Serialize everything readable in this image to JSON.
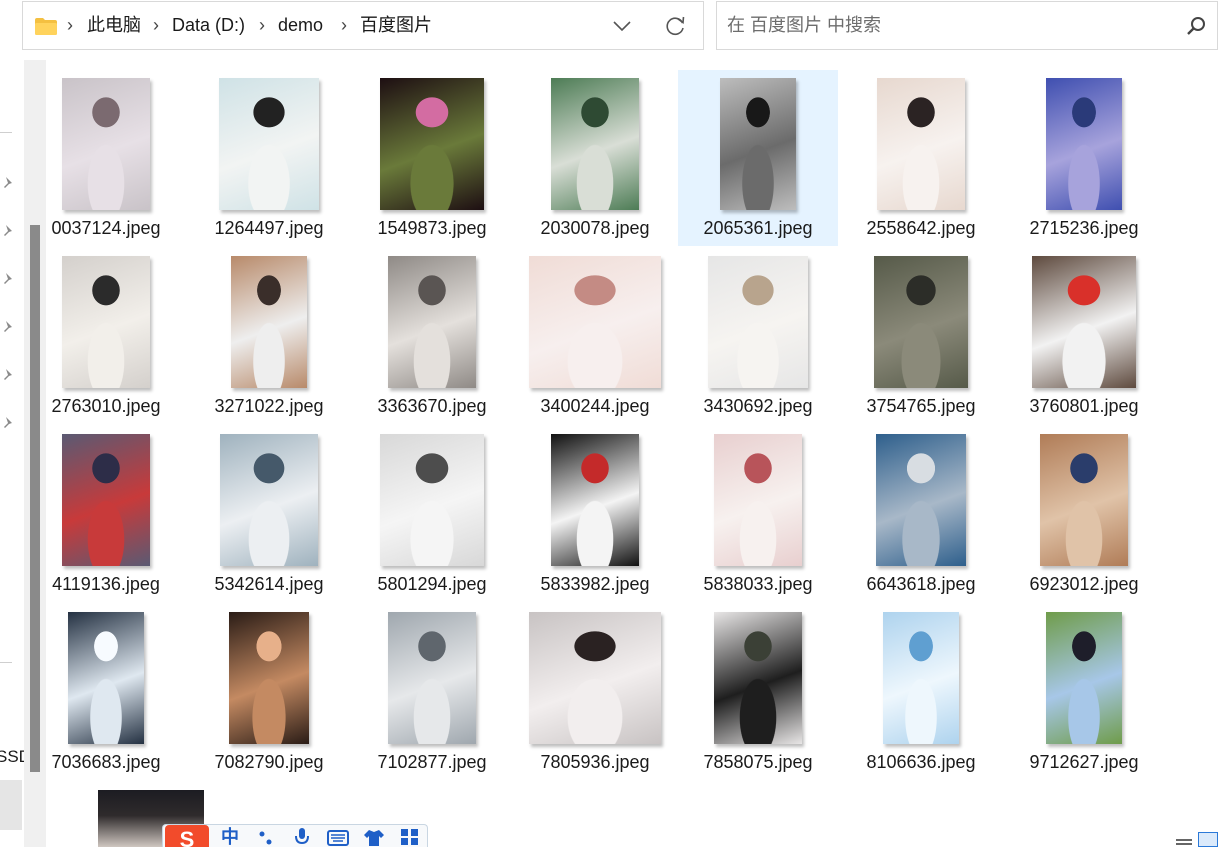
{
  "address": {
    "crumbs": [
      "此电脑",
      "Data (D:)",
      "demo",
      "百度图片"
    ],
    "separator": "›"
  },
  "search": {
    "placeholder": "在 百度图片 中搜索"
  },
  "nav": {
    "drive_fragment": "SSD"
  },
  "ime": {
    "logo": "S",
    "mode": "中"
  },
  "colors": {
    "selection": "#e5f3ff",
    "folder": "#f4c041",
    "accent": "#2b79d8"
  },
  "files": [
    {
      "name": "0037124.jpeg",
      "colors": [
        "#c9c3c8",
        "#e7e0e6",
        "#7b6a70"
      ]
    },
    {
      "name": "1264497.jpeg",
      "colors": [
        "#cfe2e6",
        "#f2f4f3",
        "#222222"
      ]
    },
    {
      "name": "1549873.jpeg",
      "colors": [
        "#1d0e12",
        "#6a7a3a",
        "#d36ca2"
      ]
    },
    {
      "name": "2030078.jpeg",
      "colors": [
        "#4d7c55",
        "#d9ded6",
        "#2e4a33"
      ]
    },
    {
      "name": "2065361.jpeg",
      "colors": [
        "#bdbdbd",
        "#6b6b6b",
        "#181818"
      ],
      "selected": true
    },
    {
      "name": "2558642.jpeg",
      "colors": [
        "#e7d8cf",
        "#f7f2ef",
        "#2b2323"
      ]
    },
    {
      "name": "2715236.jpeg",
      "colors": [
        "#3f4fb0",
        "#a7a3dc",
        "#2a3a79"
      ]
    },
    {
      "name": "2763010.jpeg",
      "colors": [
        "#d4d0cc",
        "#f2efea",
        "#2b2b2b"
      ]
    },
    {
      "name": "3271022.jpeg",
      "colors": [
        "#b88a6a",
        "#eeeeee",
        "#3a2e2a"
      ]
    },
    {
      "name": "3363670.jpeg",
      "colors": [
        "#8f8a86",
        "#e4e0dc",
        "#5a5553"
      ]
    },
    {
      "name": "3400244.jpeg",
      "colors": [
        "#f0dcd6",
        "#f7efee",
        "#c48b84"
      ]
    },
    {
      "name": "3430692.jpeg",
      "colors": [
        "#e6e6e6",
        "#f6f4f1",
        "#b8a48d"
      ]
    },
    {
      "name": "3754765.jpeg",
      "colors": [
        "#565a49",
        "#8b8a7a",
        "#2c2d28"
      ]
    },
    {
      "name": "3760801.jpeg",
      "colors": [
        "#5e4a3e",
        "#f2f2f2",
        "#d9302a"
      ]
    },
    {
      "name": "4119136.jpeg",
      "colors": [
        "#5a5a73",
        "#c83a3a",
        "#2d2d48"
      ]
    },
    {
      "name": "5342614.jpeg",
      "colors": [
        "#9fb2be",
        "#eceff2",
        "#45596a"
      ]
    },
    {
      "name": "5801294.jpeg",
      "colors": [
        "#d8d8d8",
        "#f5f5f5",
        "#4d4d4d"
      ]
    },
    {
      "name": "5833982.jpeg",
      "colors": [
        "#111111",
        "#f4f4f4",
        "#c42a2a"
      ]
    },
    {
      "name": "5838033.jpeg",
      "colors": [
        "#e8cfcf",
        "#f7f1ef",
        "#b8545a"
      ]
    },
    {
      "name": "6643618.jpeg",
      "colors": [
        "#2e5f8c",
        "#a8b8c8",
        "#d8dde2"
      ]
    },
    {
      "name": "6923012.jpeg",
      "colors": [
        "#b07c57",
        "#e0c3a8",
        "#2a3d6b"
      ]
    },
    {
      "name": "7036683.jpeg",
      "colors": [
        "#243142",
        "#dfe8f0",
        "#f7fbff"
      ]
    },
    {
      "name": "7082790.jpeg",
      "colors": [
        "#2a1c16",
        "#c48a62",
        "#e7b08a"
      ]
    },
    {
      "name": "7102877.jpeg",
      "colors": [
        "#9fa7ae",
        "#e6e8ea",
        "#5f666d"
      ]
    },
    {
      "name": "7805936.jpeg",
      "colors": [
        "#c8c3c3",
        "#f2eeee",
        "#2a2222"
      ]
    },
    {
      "name": "7858075.jpeg",
      "colors": [
        "#e8e6e6",
        "#1e1e1e",
        "#3b4036"
      ]
    },
    {
      "name": "8106636.jpeg",
      "colors": [
        "#aed3ee",
        "#eef7fd",
        "#5f9fd1"
      ]
    },
    {
      "name": "9712627.jpeg",
      "colors": [
        "#6f9c4a",
        "#a7c7e8",
        "#1e1e2a"
      ]
    }
  ]
}
